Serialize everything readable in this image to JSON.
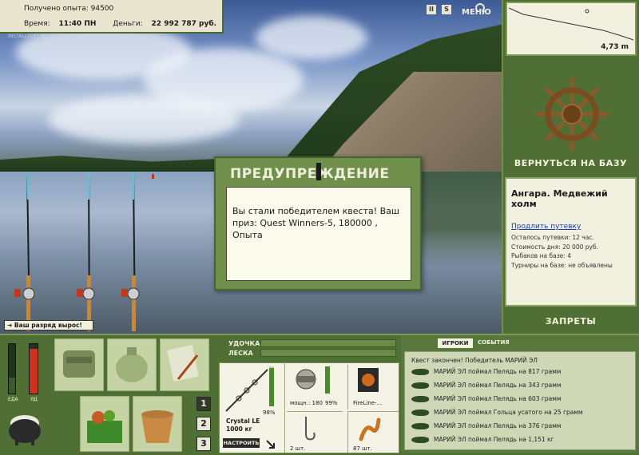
{
  "hud": {
    "exp_label": "Получено опыта:",
    "exp_value": "94500",
    "time_label": "Время:",
    "time_value": "11:40 ПН",
    "money_label": "Деньги:",
    "money_value": "22 992 787 руб."
  },
  "watermark": "INSTALLSOFT.RU",
  "top_controls": {
    "pause": "II",
    "sound": "S",
    "menu": "МЕНЮ"
  },
  "depth": {
    "value": "4,73 m"
  },
  "right_panel": {
    "return_label": "ВЕРНУТЬСЯ НА БАЗУ",
    "location": "Ангара. Медвежий холм",
    "extend_link": "Продлить путевку",
    "info_lines": [
      "Осталось путевки: 12 час.",
      "Стоимость дня: 20 000 руб.",
      "Рыбаков на базе: 4",
      "Турниры на базе: не объявлены"
    ],
    "bans_label": "ЗАПРЕТЫ"
  },
  "dialog": {
    "title": "ПРЕДУПРЕЖДЕНИЕ",
    "message": "Вы стали победителем квеста! Ваш приз: Quest Winners-5, 180000 , Опыта"
  },
  "notification": "Ваш разряд вырос!",
  "status": {
    "food_label": "ЕДА",
    "poison_label": "ЯД"
  },
  "tackle": {
    "rod_label": "УДОЧКА",
    "line_label": "ЛЕСКА",
    "rod_name": "Crystal LE",
    "rod_weight": "1000 кг",
    "rod_percent": "98%",
    "setup_button": "НАСТРОИТЬ",
    "reel_label": "мощн.: 180",
    "reel_percent": "99%",
    "line_name": "FireLine-...",
    "hook_count": "2 шт.",
    "bait_count": "87 шт."
  },
  "slots": [
    "1",
    "2",
    "3"
  ],
  "events_panel": {
    "tab_players": "ИГРОКИ",
    "tab_events": "СОБЫТИЯ",
    "header": "Квест закончен! Победитель МАРИЙ ЭЛ",
    "rows": [
      "МАРИЙ ЭЛ поймал Пелядь на 817 грамм",
      "МАРИЙ ЭЛ поймал Пелядь на 343 грамм",
      "МАРИЙ ЭЛ поймал Пелядь на 603 грамм",
      "МАРИЙ ЭЛ поймал Гольца усатого на 25 грамм",
      "МАРИЙ ЭЛ поймал Пелядь на 376 грамм",
      "МАРИЙ ЭЛ поймал Пелядь на 1,151 кг"
    ]
  },
  "colors": {
    "panel_green": "#4f6f34",
    "cream": "#f2f0de",
    "title_cream": "#eeeedc",
    "link_blue": "#1a3fb0",
    "bar_red": "#d0301c"
  },
  "icons": [
    "ship-wheel-icon",
    "rod-icon",
    "reel-icon",
    "hook-icon",
    "worm-icon",
    "fish-icon",
    "bag-icon",
    "basket-icon",
    "bucket-icon",
    "pot-icon",
    "map-icon",
    "arrow-icon"
  ]
}
